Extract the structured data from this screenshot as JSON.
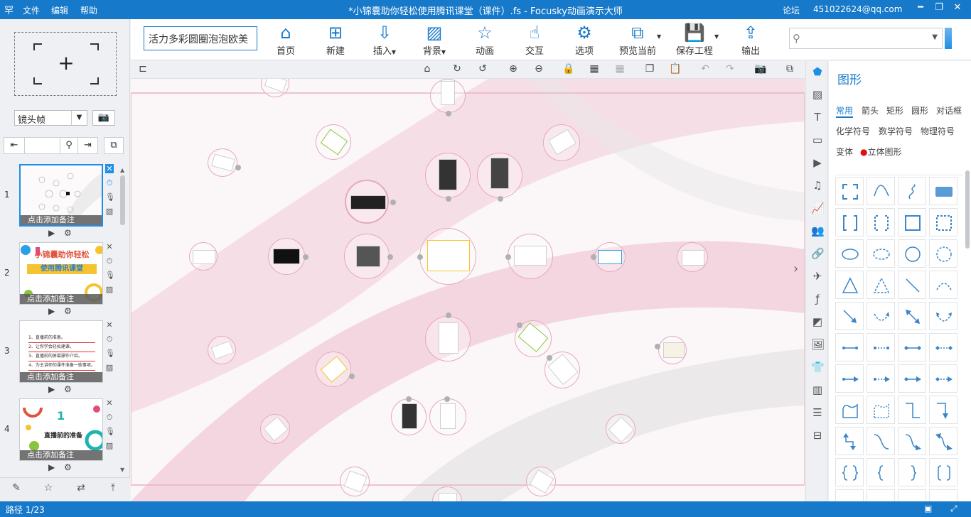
{
  "titlebar": {
    "logo": "罕",
    "menu_file": "文件",
    "menu_edit": "编辑",
    "menu_help": "帮助",
    "title": "*小锦囊助你轻松使用腾讯课堂（课件）.fs - Focusky动画演示大师",
    "forum": "论坛",
    "account": "451022624@qq.com"
  },
  "left": {
    "frame_select": "镜头帧",
    "slides": [
      {
        "num": "1",
        "note": "点击添加备注"
      },
      {
        "num": "2",
        "note": "点击添加备注",
        "text_a": "小锦囊助你轻松",
        "text_b": "使用腾讯课堂"
      },
      {
        "num": "3",
        "note": "点击添加备注",
        "lines": [
          "1、直播前的准备。",
          "2、让你学会轻松建课。",
          "3、直播前的屏幕操作介绍。",
          "4、为主讲师的课件准备一些事项。"
        ]
      },
      {
        "num": "4",
        "note": "点击添加备注",
        "big_num": "1",
        "caption": "直播前的准备"
      }
    ]
  },
  "ribbon": {
    "presentation_name": "活力多彩圆圈泡泡欧美",
    "tools": [
      {
        "label": "首页",
        "icon": "home-icon",
        "glyph": "⌂"
      },
      {
        "label": "新建",
        "icon": "new-icon",
        "glyph": "⊞"
      },
      {
        "label": "插入",
        "icon": "insert-icon",
        "glyph": "⇩"
      },
      {
        "label": "背景",
        "icon": "background-icon",
        "glyph": "▨"
      },
      {
        "label": "动画",
        "icon": "animation-icon",
        "glyph": "☆"
      },
      {
        "label": "交互",
        "icon": "interaction-icon",
        "glyph": "☝"
      },
      {
        "label": "选项",
        "icon": "options-icon",
        "glyph": "⚙"
      },
      {
        "label": "预览当前",
        "icon": "preview-icon",
        "glyph": "⧉"
      },
      {
        "label": "保存工程",
        "icon": "save-icon",
        "glyph": "💾"
      },
      {
        "label": "输出",
        "icon": "export-icon",
        "glyph": "⇪"
      }
    ]
  },
  "panel": {
    "title": "图形",
    "categories_row1": [
      "常用",
      "箭头",
      "矩形",
      "圆形",
      "对话框"
    ],
    "categories_row2": [
      "化学符号",
      "数学符号",
      "物理符号"
    ],
    "categories_row3": [
      "变体",
      "立体图形"
    ]
  },
  "status": {
    "path": "路径 1/23"
  },
  "colors": {
    "brand": "#1779c9",
    "accent": "#1f8fe6",
    "path_ring": "#e6a9bb"
  }
}
